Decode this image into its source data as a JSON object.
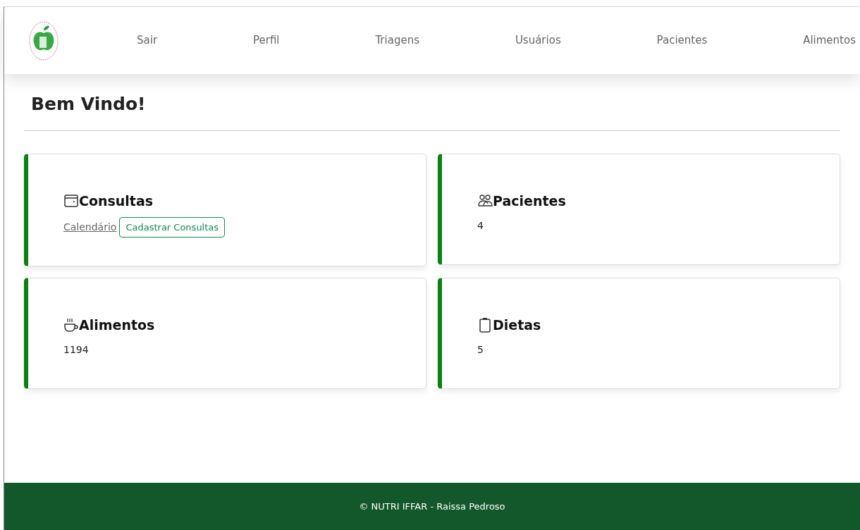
{
  "navbar": {
    "items": [
      "Sair",
      "Perfil",
      "Triagens",
      "Usuários",
      "Pacientes",
      "Alimentos"
    ]
  },
  "heading": "Bem Vindo!",
  "cards": [
    {
      "kind": "links",
      "title": "Consultas",
      "link": "Calendário",
      "button": "Cadastrar Consultas"
    },
    {
      "kind": "count",
      "title": "Pacientes",
      "value": "4"
    },
    {
      "kind": "count",
      "title": "Alimentos",
      "value": "1194"
    },
    {
      "kind": "count",
      "title": "Dietas",
      "value": "5"
    }
  ],
  "footer": "© NUTRI IFFAR - Raissa Pedroso"
}
